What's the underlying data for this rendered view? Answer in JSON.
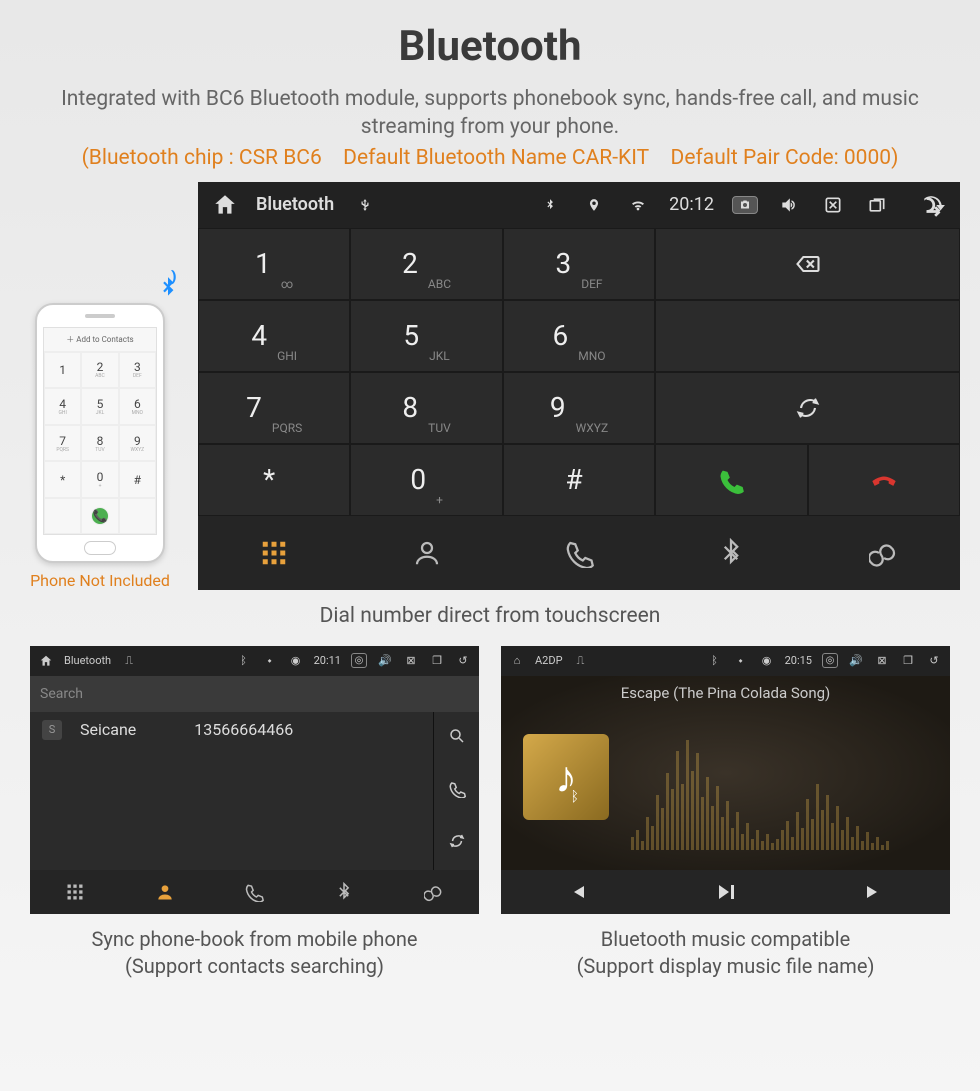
{
  "header": {
    "title": "Bluetooth",
    "subtitle": "Integrated with BC6 Bluetooth module, supports phonebook sync, hands-free call, and music streaming from your phone.",
    "chipline": "(Bluetooth chip : CSR BC6 Default Bluetooth Name CAR-KIT Default Pair Code: 0000)"
  },
  "phone": {
    "add_contacts": "Add to Contacts",
    "caption": "Phone Not Included",
    "keys": [
      {
        "d": "1",
        "s": ""
      },
      {
        "d": "2",
        "s": "ABC"
      },
      {
        "d": "3",
        "s": "DEF"
      },
      {
        "d": "4",
        "s": "GHI"
      },
      {
        "d": "5",
        "s": "JKL"
      },
      {
        "d": "6",
        "s": "MNO"
      },
      {
        "d": "7",
        "s": "PQRS"
      },
      {
        "d": "8",
        "s": "TUV"
      },
      {
        "d": "9",
        "s": "WXYZ"
      },
      {
        "d": "*",
        "s": ""
      },
      {
        "d": "0",
        "s": "+"
      },
      {
        "d": "#",
        "s": ""
      }
    ]
  },
  "dialer": {
    "status": {
      "title": "Bluetooth",
      "time": "20:12"
    },
    "keys": [
      {
        "d": "1",
        "s": "∞"
      },
      {
        "d": "2",
        "s": "ABC"
      },
      {
        "d": "3",
        "s": "DEF"
      },
      {
        "d": "4",
        "s": "GHI"
      },
      {
        "d": "5",
        "s": "JKL"
      },
      {
        "d": "6",
        "s": "MNO"
      },
      {
        "d": "7",
        "s": "PQRS"
      },
      {
        "d": "8",
        "s": "TUV"
      },
      {
        "d": "9",
        "s": "WXYZ"
      },
      {
        "d": "*",
        "s": ""
      },
      {
        "d": "0",
        "s": "+"
      },
      {
        "d": "#",
        "s": ""
      }
    ],
    "caption": "Dial number direct from touchscreen"
  },
  "contacts": {
    "status": {
      "title": "Bluetooth",
      "time": "20:11"
    },
    "search_placeholder": "Search",
    "rows": [
      {
        "initial": "S",
        "name": "Seicane",
        "number": "13566664466"
      }
    ],
    "caption_l1": "Sync phone-book from mobile phone",
    "caption_l2": "(Support contacts searching)"
  },
  "music": {
    "status": {
      "title": "A2DP",
      "time": "20:15"
    },
    "song": "Escape (The Pina Colada Song)",
    "caption_l1": "Bluetooth music compatible",
    "caption_l2": "(Support display music file name)"
  }
}
